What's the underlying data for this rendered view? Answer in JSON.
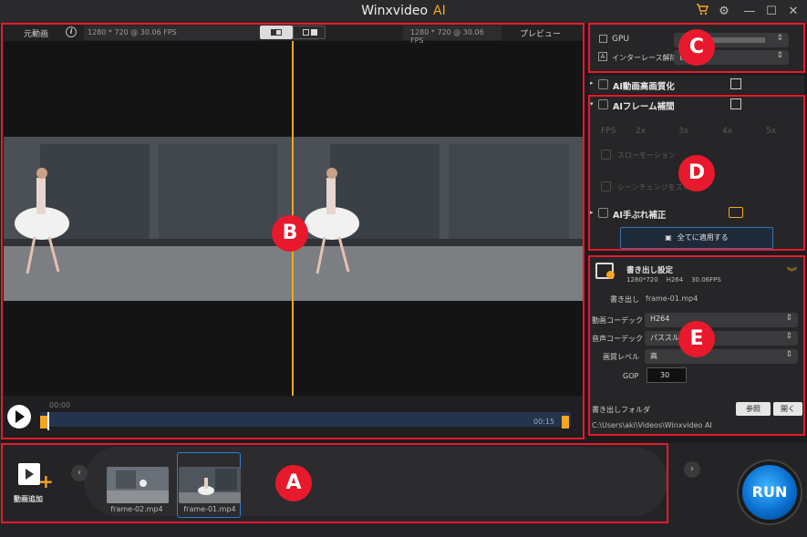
{
  "app": {
    "title": "Winxvideo",
    "title_ai": "AI"
  },
  "preview": {
    "left_label": "元動画",
    "right_label": "プレビュー",
    "left_info": "1280 * 720 @ 30.06 FPS",
    "right_info": "1280 * 720 @ 30.06 FPS",
    "time_start": "00:00",
    "time_end": "00:15"
  },
  "gpu_panel": {
    "gpu_label": "GPU",
    "deinterlace_label": "インターレース解除",
    "deinterlace_value": "自"
  },
  "ai_modules": {
    "upscale_label": "AI動画高画質化",
    "frame_interp_label": "AIフレーム補間",
    "fps_label": "FPS",
    "fps_options": [
      "2x",
      "3x",
      "4x",
      "5x"
    ],
    "slowmo_label": "スローモーション",
    "scene_label": "シーンチェンジをスキップ",
    "stabilize_label": "AI手ぶれ補正",
    "apply_all_label": "全てに適用する"
  },
  "export": {
    "title": "書き出し設定",
    "summary": "1280*720    H264    30.06FPS",
    "output_label": "書き出し",
    "output_file": "frame-01.mp4",
    "video_codec_label": "動画コーデック",
    "video_codec_value": "H264",
    "audio_codec_label": "音声コーデック",
    "audio_codec_value": "パススルー",
    "quality_label": "画質レベル",
    "quality_value": "高",
    "gop_label": "GOP",
    "gop_value": "30",
    "folder_label": "書き出しフォルダ",
    "browse_label": "参照",
    "open_label": "開く",
    "folder_path": "C:\\Users\\aki\\Videos\\Winxvideo AI"
  },
  "files": {
    "add_label": "動画追加",
    "items": [
      {
        "name": "frame-02.mp4"
      },
      {
        "name": "frame-01.mp4"
      }
    ]
  },
  "run_label": "RUN",
  "annotations": {
    "a": "A",
    "b": "B",
    "c": "C",
    "d": "D",
    "e": "E"
  },
  "colors": {
    "accent": "#f6a623",
    "highlight": "#e8192c",
    "run": "#0a6fd1"
  }
}
